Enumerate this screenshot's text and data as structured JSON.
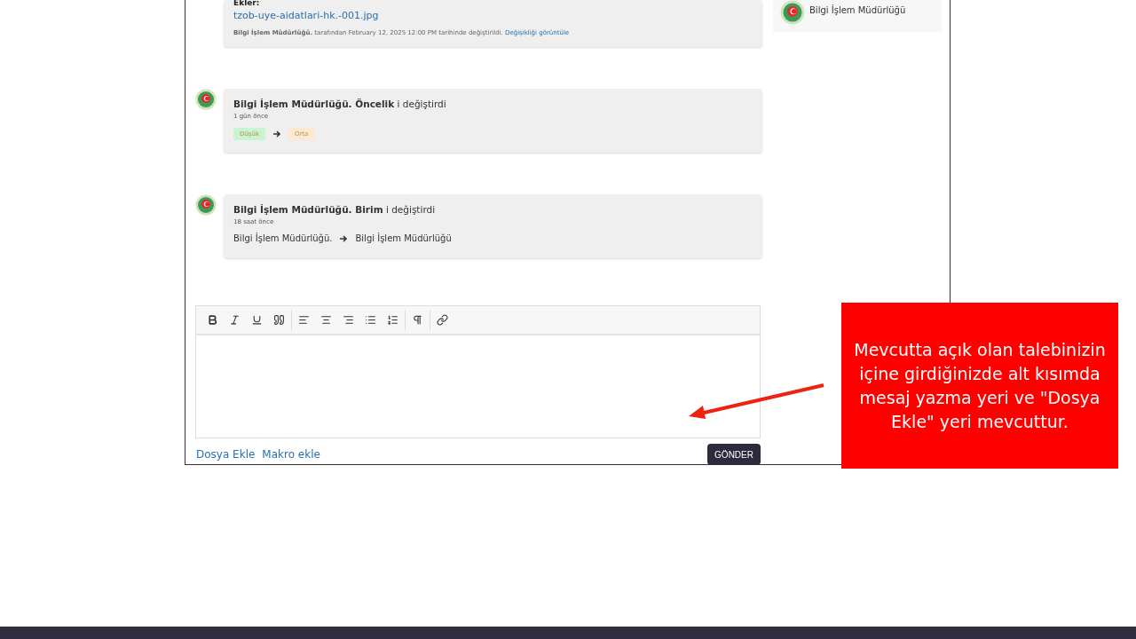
{
  "attachment_card": {
    "label": "Ekler:",
    "file": "tzob-uye-aidatlari-hk.-001.jpg",
    "footer": "**Bilgi İşlem Müdürlüğü.** tarafından February 12, 2025 12:00 PM tarihinde değiştirildi.",
    "footer_link": "Değişikliği görüntüle"
  },
  "activities": [
    {
      "kind": "badges",
      "title": "**Bilgi İşlem Müdürlüğü. Öncelik** i değiştirdi",
      "time": "1 gün önce",
      "from": {
        "label": "Düşük",
        "color": "#c8f5d0"
      },
      "to": {
        "label": "Orta",
        "color": "#fde9cf"
      }
    },
    {
      "kind": "text",
      "title": "**Bilgi İşlem Müdürlüğü. Birim** i değiştirdi",
      "time": "18 saat önce",
      "from": {
        "label": "Bilgi İşlem Müdürlüğü."
      },
      "to": {
        "label": "Bilgi İşlem Müdürlüğü"
      }
    }
  ],
  "editor": {
    "links": [
      "Dosya Ekle",
      "Makro ekle"
    ],
    "submit": "GÖNDER"
  },
  "sidebar": {
    "name": "Bilgi İşlem Müdürlüğü"
  },
  "callout": {
    "text": "Mevcutta açık olan talebinizin içine girdiğinizde alt kısımda mesaj yazma yeri ve \"Dosya Ekle\" yeri mevcuttur."
  }
}
